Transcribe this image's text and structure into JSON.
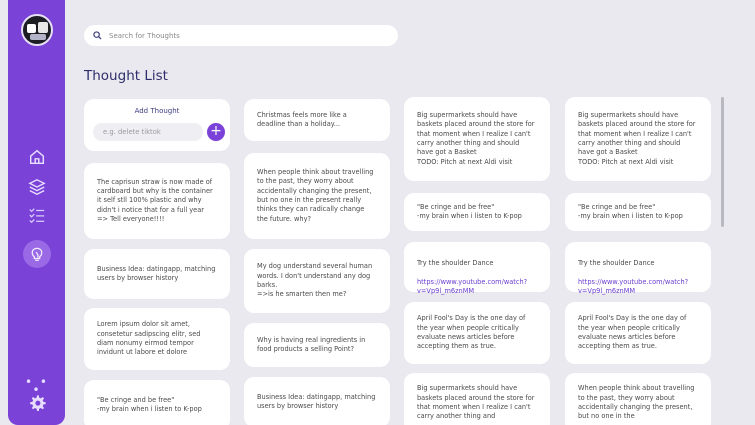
{
  "sidebar": {
    "logo_icon": "robot-avatar-icon",
    "items": [
      {
        "name": "home-icon"
      },
      {
        "name": "layers-icon"
      },
      {
        "name": "checklist-icon"
      },
      {
        "name": "lightbulb-icon"
      }
    ],
    "more_icon": "more-dots-icon",
    "settings_icon": "gear-icon",
    "accent": "#7b42d8"
  },
  "search": {
    "placeholder": "Search for Thoughts"
  },
  "page_title": "Thought List",
  "add_thought": {
    "title": "Add Thought",
    "placeholder": "e.g. delete tiktok",
    "button": "+"
  },
  "columns": [
    [
      {
        "text": "The caprisun straw is now made of cardboard but why is the container it self stll 100% plastic and why didn't i notice that for a full year => Tell everyone!!!!"
      },
      {
        "text": "Business Idea: datingapp, matching users by browser history"
      },
      {
        "text": "Lorem ipsum dolor sit amet, consetetur sadipscing elitr, sed diam nonumy eirmod tempor invidunt ut labore et dolore"
      },
      {
        "text": "\"Be cringe and be free\"\n-my brain when i listen to K-pop"
      }
    ],
    [
      {
        "text": "Christmas feels more like a deadline than a holiday..."
      },
      {
        "text": "When people think about travelling to the past, they worry about accidentally changing the present, but no one in the present really thinks they can radically change the future. why?"
      },
      {
        "text": "My dog understand several human words. I don't understand any dog barks.\n=>is he smarten then me?"
      },
      {
        "text": "Why is having real ingredients in food products a selling Point?"
      },
      {
        "text": "Business Idea: datingapp, matching users by browser history"
      }
    ],
    [
      {
        "text": "Big supermarkets should have baskets placed around the store for that moment when I realize I can't carry another thing and should have got a Basket\nTODO: Pitch at next Aldi visit"
      },
      {
        "text": "\"Be cringe and be free\"\n-my brain when i listen to K-pop"
      },
      {
        "text": "Try the shoulder Dance",
        "link": "https://www.youtube.com/watch?v=Vp9l_m6znMM"
      },
      {
        "text": "April Fool's Day is the one day of the year when people critically evaluate news articles before accepting them as true."
      },
      {
        "text": "Big supermarkets should have baskets placed around the store for that moment when I realize I can't carry another thing and"
      }
    ],
    [
      {
        "text": "Big supermarkets should have baskets placed around the store for that moment when I realize I can't carry another thing and should have got a Basket\nTODO: Pitch at next Aldi visit"
      },
      {
        "text": "\"Be cringe and be free\"\n-my brain when i listen to K-pop"
      },
      {
        "text": "Try the shoulder Dance",
        "link": "https://www.youtube.com/watch?v=Vp9l_m6znMM"
      },
      {
        "text": "April Fool's Day is the one day of the year when people critically evaluate news articles before accepting them as true."
      },
      {
        "text": "When people think about travelling to the past, they worry about accidentally changing the present, but no one in the"
      }
    ]
  ]
}
